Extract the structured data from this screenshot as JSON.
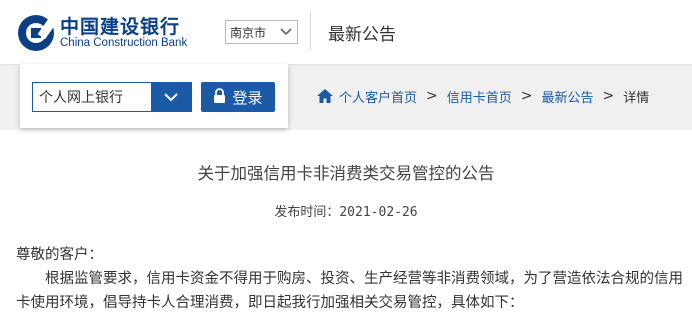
{
  "header": {
    "brand_cn": "中国建设银行",
    "brand_en": "China Construction Bank",
    "city": "南京市",
    "title": "最新公告"
  },
  "login": {
    "bank_select_label": "个人网上银行",
    "login_label": "登录"
  },
  "breadcrumb": {
    "items": [
      "个人客户首页",
      "信用卡首页",
      "最新公告"
    ],
    "current": "详情",
    "separator": ">"
  },
  "article": {
    "title": "关于加强信用卡非消费类交易管控的公告",
    "date_label": "发布时间：",
    "date_value": "2021-02-26",
    "greeting": "尊敬的客户：",
    "paragraph": "根据监管要求，信用卡资金不得用于购房、投资、生产经营等非消费领域，为了营造依法合规的信用卡使用环境，倡导持卡人合理消费，即日起我行加强相关交易管控，具体如下："
  },
  "icons": {
    "logo": "ccb-logo-icon",
    "city_dropdown": "chevron-down-icon",
    "bank_dropdown": "chevron-down-icon",
    "lock": "lock-icon",
    "home": "home-icon"
  },
  "colors": {
    "brand": "#0a3f86",
    "accent": "#1a5aa6",
    "nav_background": "#f0f0f0"
  }
}
